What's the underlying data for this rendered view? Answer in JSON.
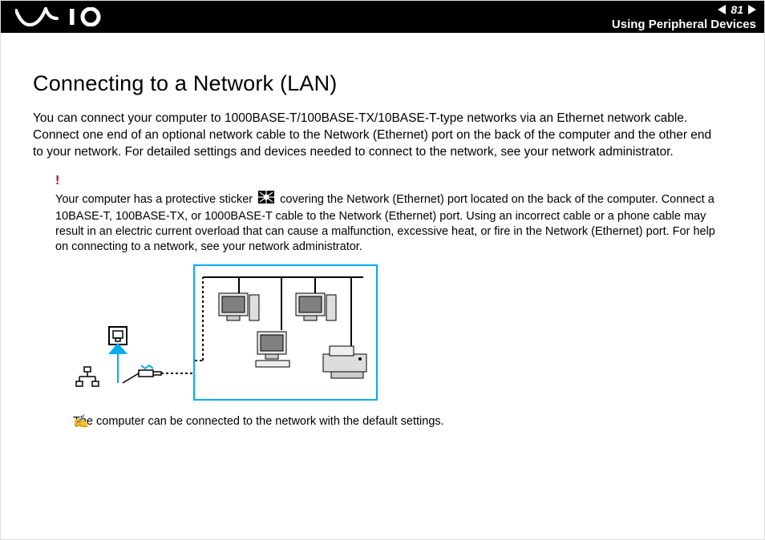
{
  "header": {
    "page_number": "81",
    "section": "Using Peripheral Devices"
  },
  "title": "Connecting to a Network (LAN)",
  "intro": "You can connect your computer to 1000BASE-T/100BASE-TX/10BASE-T-type networks via an Ethernet network cable. Connect one end of an optional network cable to the Network (Ethernet) port on the back of the computer and the other end to your network. For detailed settings and devices needed to connect to the network, see your network administrator.",
  "warning": {
    "mark": "!",
    "text_before_icon": "Your computer has a protective sticker ",
    "text_after_icon": " covering the Network (Ethernet) port located on the back of the computer. Connect a 10BASE-T, 100BASE-TX, or 1000BASE-T cable to the Network (Ethernet) port. Using an incorrect cable or a phone cable may result in an electric current overload that can cause a malfunction, excessive heat, or fire in the Network (Ethernet) port. For help on connecting to a network, see your network administrator."
  },
  "note": {
    "text": "The computer can be connected to the network with the default settings."
  }
}
